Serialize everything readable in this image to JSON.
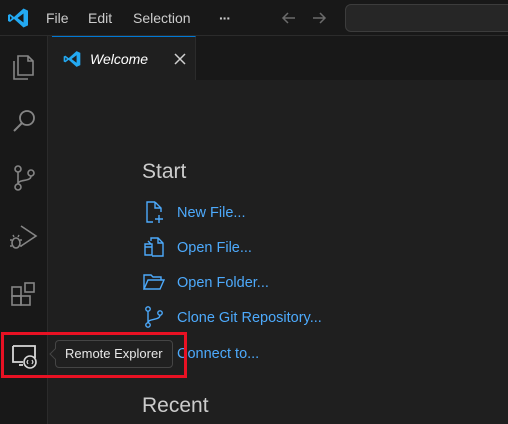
{
  "menu": {
    "file": "File",
    "edit": "Edit",
    "selection": "Selection",
    "more": "···"
  },
  "activity_bar": {
    "items": [
      {
        "name": "explorer",
        "icon": "files-icon"
      },
      {
        "name": "search",
        "icon": "search-icon"
      },
      {
        "name": "source-control",
        "icon": "source-control-icon"
      },
      {
        "name": "run-and-debug",
        "icon": "run-debug-icon"
      },
      {
        "name": "extensions",
        "icon": "extensions-icon"
      },
      {
        "name": "remote-explorer",
        "icon": "remote-explorer-icon"
      }
    ]
  },
  "tooltip": {
    "text": "Remote Explorer"
  },
  "tabs": [
    {
      "label": "Welcome",
      "active": true
    }
  ],
  "welcome": {
    "start_heading": "Start",
    "actions": [
      {
        "label": "New File...",
        "icon": "new-file-icon"
      },
      {
        "label": "Open File...",
        "icon": "open-file-icon"
      },
      {
        "label": "Open Folder...",
        "icon": "open-folder-icon"
      },
      {
        "label": "Clone Git Repository...",
        "icon": "git-branch-icon"
      },
      {
        "label": "Connect to...",
        "icon": "remote-icon"
      }
    ],
    "recent_heading": "Recent"
  },
  "colors": {
    "accent": "#0078d4",
    "link": "#4daafc",
    "highlight": "#e81123",
    "vscode_blue": "#23a9f2"
  }
}
